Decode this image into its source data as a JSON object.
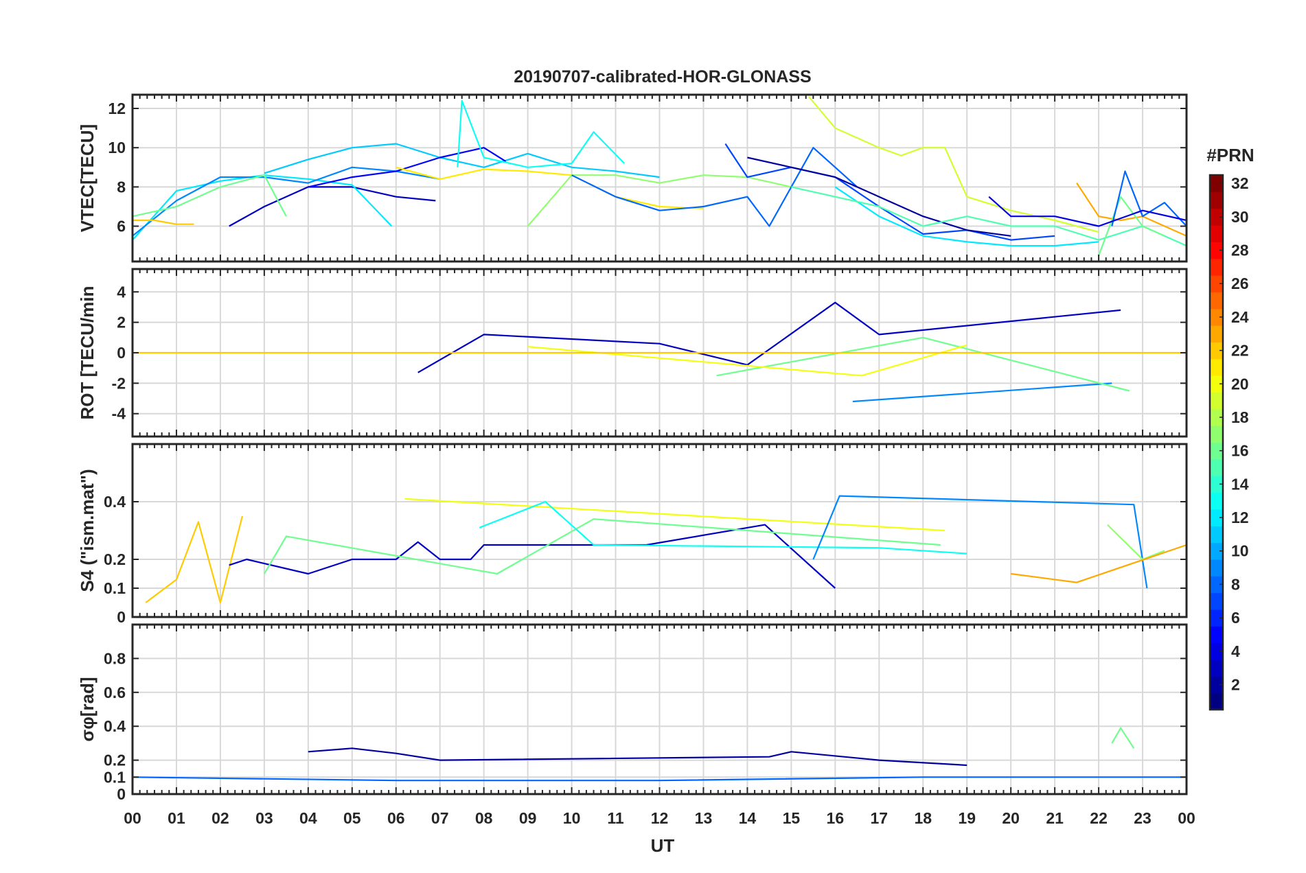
{
  "chart_data": {
    "type": "line",
    "title": "20190707-calibrated-HOR-GLONASS",
    "xlabel": "UT",
    "xlim": [
      0,
      24
    ],
    "x_tick_labels": [
      "00",
      "01",
      "02",
      "03",
      "04",
      "05",
      "06",
      "07",
      "08",
      "09",
      "10",
      "11",
      "12",
      "13",
      "14",
      "15",
      "16",
      "17",
      "18",
      "19",
      "20",
      "21",
      "22",
      "23",
      "00"
    ],
    "grid": true,
    "colorbar": {
      "label": "#PRN",
      "range": [
        1,
        32
      ],
      "tick_labels": [
        "2",
        "4",
        "6",
        "8",
        "10",
        "12",
        "14",
        "16",
        "18",
        "20",
        "22",
        "24",
        "26",
        "28",
        "30",
        "32"
      ],
      "colormap": "jet",
      "placement": "right"
    },
    "panels": [
      {
        "id": "vtec",
        "ylabel": "VTEC[TECU]",
        "ylim": [
          4.2,
          12.7
        ],
        "y_ticks": [
          6,
          8,
          10,
          12
        ],
        "y_tick_labels": [
          "6",
          "8",
          "10",
          "12"
        ],
        "series": [
          {
            "prn": 3,
            "x": [
              2.2,
              3.0,
              4.0,
              5.0,
              6.0,
              6.9
            ],
            "y": [
              6.0,
              7.0,
              8.0,
              8.0,
              7.5,
              7.3
            ]
          },
          {
            "prn": 12,
            "x": [
              0.0,
              1.0,
              2.0,
              3.0,
              4.0,
              5.0,
              5.9
            ],
            "y": [
              5.3,
              7.8,
              8.3,
              8.6,
              8.4,
              8.1,
              6.0
            ]
          },
          {
            "prn": 9,
            "x": [
              0.0,
              1.0,
              2.0,
              3.0,
              4.0,
              5.0,
              6.0,
              7.0
            ],
            "y": [
              5.5,
              7.3,
              8.5,
              8.5,
              8.2,
              9.0,
              8.8,
              8.4
            ]
          },
          {
            "prn": 11,
            "x": [
              3.0,
              4.0,
              5.0,
              6.0,
              7.0,
              8.0,
              9.0,
              10.0,
              11.0,
              12.0
            ],
            "y": [
              8.7,
              9.4,
              10.0,
              10.2,
              9.5,
              9.0,
              9.7,
              9.0,
              8.8,
              8.5
            ]
          },
          {
            "prn": 16,
            "x": [
              0.0,
              1.0,
              2.0,
              3.0,
              3.5
            ],
            "y": [
              6.5,
              7.0,
              8.0,
              8.6,
              6.5
            ]
          },
          {
            "prn": 22,
            "x": [
              0.0,
              0.5,
              1.0,
              1.4
            ],
            "y": [
              6.3,
              6.3,
              6.1,
              6.1
            ]
          },
          {
            "prn": 5,
            "x": [
              4.0,
              5.0,
              6.0,
              7.0,
              8.0,
              8.5
            ],
            "y": [
              8.0,
              8.5,
              8.8,
              9.5,
              10.0,
              9.3
            ]
          },
          {
            "prn": 21,
            "x": [
              6.0,
              7.0,
              8.0,
              9.0,
              10.0,
              11.0,
              12.0,
              13.0
            ],
            "y": [
              9.0,
              8.4,
              8.9,
              8.8,
              8.6,
              7.5,
              7.0,
              6.9
            ]
          },
          {
            "prn": 13,
            "x": [
              7.4,
              7.5,
              8.0,
              9.0,
              10.0,
              10.5,
              11.2
            ],
            "y": [
              9.0,
              12.4,
              9.5,
              9.0,
              9.2,
              10.8,
              9.2
            ]
          },
          {
            "prn": 17,
            "x": [
              9.0,
              10.0,
              11.0,
              12.0,
              13.0,
              14.0,
              15.0
            ],
            "y": [
              6.0,
              8.6,
              8.6,
              8.2,
              8.6,
              8.5,
              8.0
            ]
          },
          {
            "prn": 8,
            "x": [
              10.0,
              11.0,
              12.0,
              13.0,
              14.0,
              14.5,
              15.5,
              16.5
            ],
            "y": [
              8.6,
              7.5,
              6.8,
              7.0,
              7.5,
              6.0,
              10.0,
              8.0
            ]
          },
          {
            "prn": 7,
            "x": [
              13.5,
              14.0,
              15.0,
              16.0,
              17.0,
              18.0,
              19.0,
              20.0,
              21.0
            ],
            "y": [
              10.2,
              8.5,
              9.0,
              8.5,
              7.0,
              5.6,
              5.8,
              5.3,
              5.5
            ]
          },
          {
            "prn": 2,
            "x": [
              14.0,
              15.0,
              16.0,
              17.0,
              18.0,
              19.0,
              20.0
            ],
            "y": [
              9.5,
              9.0,
              8.5,
              7.5,
              6.5,
              5.8,
              5.5
            ]
          },
          {
            "prn": 19,
            "x": [
              15.4,
              16.0,
              17.0,
              17.5,
              18.0,
              18.5,
              19.0,
              20.0,
              21.0,
              22.0
            ],
            "y": [
              12.6,
              11.0,
              10.0,
              9.6,
              10.0,
              10.0,
              7.5,
              6.8,
              6.3,
              5.7
            ]
          },
          {
            "prn": 12,
            "x": [
              16.0,
              17.0,
              18.0,
              19.0,
              20.0,
              21.0,
              22.0
            ],
            "y": [
              8.0,
              6.5,
              5.5,
              5.2,
              5.0,
              5.0,
              5.2
            ]
          },
          {
            "prn": 15,
            "x": [
              15.0,
              16.0,
              17.0,
              18.0,
              19.0,
              20.0,
              21.0,
              22.0,
              23.0,
              24.0
            ],
            "y": [
              8.0,
              7.5,
              7.0,
              6.0,
              6.5,
              6.0,
              6.0,
              5.3,
              6.0,
              5.0
            ]
          },
          {
            "prn": 23,
            "x": [
              21.5,
              22.0,
              22.5,
              23.0,
              24.0
            ],
            "y": [
              8.2,
              6.5,
              6.3,
              6.5,
              5.5
            ]
          },
          {
            "prn": 16,
            "x": [
              22.0,
              22.5,
              23.0,
              23.5
            ],
            "y": [
              4.5,
              7.5,
              6.0,
              5.5
            ]
          },
          {
            "prn": 8,
            "x": [
              22.3,
              22.6,
              23.0,
              23.5,
              24.0
            ],
            "y": [
              6.0,
              8.8,
              6.5,
              7.2,
              6.0
            ]
          },
          {
            "prn": 4,
            "x": [
              19.5,
              20.0,
              21.0,
              22.0,
              23.0,
              24.0
            ],
            "y": [
              7.5,
              6.5,
              6.5,
              6.0,
              6.8,
              6.3
            ]
          }
        ]
      },
      {
        "id": "rot",
        "ylabel": "ROT [TECU/min",
        "ylim": [
          -5.5,
          5.5
        ],
        "y_ticks": [
          -4,
          -2,
          0,
          2,
          4
        ],
        "y_tick_labels": [
          "-4",
          "-2",
          "0",
          "2",
          "4"
        ],
        "series": [
          {
            "prn": 3,
            "x": [
              6.5,
              8.0,
              12.0,
              14.0,
              16.0,
              17.0,
              22.5
            ],
            "y": [
              -1.3,
              1.2,
              0.6,
              -0.8,
              3.3,
              1.2,
              2.8
            ]
          },
          {
            "prn": 9,
            "x": [
              16.4,
              22.3
            ],
            "y": [
              -3.2,
              -2.0
            ]
          },
          {
            "prn": 16,
            "x": [
              13.3,
              18.0,
              22.7
            ],
            "y": [
              -1.5,
              1.0,
              -2.5
            ]
          },
          {
            "prn": 20,
            "x": [
              9.0,
              16.6,
              19.0
            ],
            "y": [
              0.4,
              -1.5,
              0.5
            ]
          },
          {
            "prn": 22,
            "x": [
              0.0,
              6.0,
              12.0,
              18.0,
              24.0
            ],
            "y": [
              0.0,
              0.0,
              0.0,
              0.0,
              0.0
            ]
          }
        ]
      },
      {
        "id": "s4",
        "ylabel": "S4 (\"ism.mat\")",
        "ylim": [
          0,
          0.6
        ],
        "y_ticks": [
          0,
          0.1,
          0.2,
          0.4
        ],
        "y_tick_labels": [
          "0",
          "0.1",
          "0.2",
          "0.4"
        ],
        "series": [
          {
            "prn": 22,
            "x": [
              0.3,
              1.0,
              1.5,
              2.0,
              2.5
            ],
            "y": [
              0.05,
              0.13,
              0.33,
              0.05,
              0.35
            ]
          },
          {
            "prn": 3,
            "x": [
              2.2,
              2.6,
              4.0,
              5.0,
              6.0,
              6.5,
              7.0,
              7.7,
              8.0,
              11.7,
              14.4,
              16.0
            ],
            "y": [
              0.18,
              0.2,
              0.15,
              0.2,
              0.2,
              0.26,
              0.2,
              0.2,
              0.25,
              0.25,
              0.32,
              0.1
            ]
          },
          {
            "prn": 16,
            "x": [
              3.0,
              3.5,
              8.3,
              10.5,
              18.4
            ],
            "y": [
              0.15,
              0.28,
              0.15,
              0.34,
              0.25
            ]
          },
          {
            "prn": 20,
            "x": [
              6.2,
              18.5
            ],
            "y": [
              0.41,
              0.3
            ]
          },
          {
            "prn": 13,
            "x": [
              7.9,
              9.4,
              10.5,
              17.0,
              19.0
            ],
            "y": [
              0.31,
              0.4,
              0.25,
              0.24,
              0.22
            ]
          },
          {
            "prn": 9,
            "x": [
              15.5,
              16.1,
              22.8,
              23.1
            ],
            "y": [
              0.2,
              0.42,
              0.39,
              0.1
            ]
          },
          {
            "prn": 17,
            "x": [
              22.2,
              23.0,
              23.5
            ],
            "y": [
              0.32,
              0.2,
              0.23
            ]
          },
          {
            "prn": 23,
            "x": [
              20.0,
              21.5,
              24.0
            ],
            "y": [
              0.15,
              0.12,
              0.25
            ]
          }
        ]
      },
      {
        "id": "sigphi",
        "ylabel": "σφ[rad]",
        "ylim": [
          0,
          1.0
        ],
        "y_ticks": [
          0,
          0.1,
          0.2,
          0.4,
          0.6,
          0.8
        ],
        "y_tick_labels": [
          "0",
          "0.1",
          "0.2",
          "0.4",
          "0.6",
          "0.8"
        ],
        "series": [
          {
            "prn": 2,
            "x": [
              4.0,
              5.0,
              6.0,
              7.0,
              14.5,
              15.0,
              17.0,
              19.0
            ],
            "y": [
              0.25,
              0.27,
              0.24,
              0.2,
              0.22,
              0.25,
              0.2,
              0.17
            ]
          },
          {
            "prn": 16,
            "x": [
              22.3,
              22.5,
              22.8
            ],
            "y": [
              0.3,
              0.39,
              0.27
            ]
          },
          {
            "prn": 8,
            "x": [
              0.0,
              6.0,
              12.0,
              18.0,
              24.0
            ],
            "y": [
              0.1,
              0.08,
              0.08,
              0.1,
              0.1
            ]
          }
        ]
      }
    ]
  }
}
